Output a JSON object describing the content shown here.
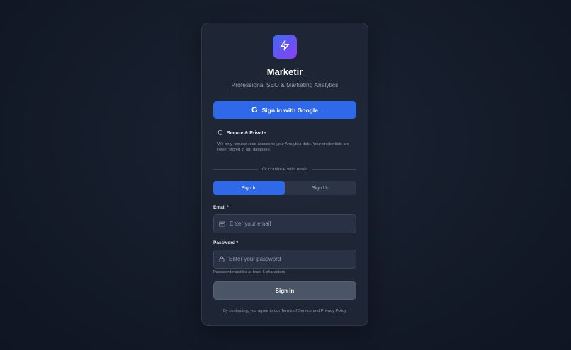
{
  "brand": {
    "name": "Marketir",
    "tagline": "Professional SEO & Marketing Analytics",
    "logo_icon": "lightning-bolt-icon",
    "gradient": [
      "#3d6bf0",
      "#8b3ff2"
    ]
  },
  "google": {
    "label": "Sign in with Google",
    "icon": "google-g-icon"
  },
  "secure": {
    "title": "Secure & Private",
    "icon": "shield-icon",
    "text": "We only request read access to your Analytics data. Your credentials are never stored in our database."
  },
  "divider": {
    "text": "Or continue with email"
  },
  "tabs": [
    {
      "label": "Sign In",
      "active": true
    },
    {
      "label": "Sign Up",
      "active": false
    }
  ],
  "form": {
    "email_label": "Email *",
    "email_placeholder": "Enter your email",
    "email_value": "",
    "email_icon": "mail-icon",
    "password_label": "Password *",
    "password_placeholder": "Enter your password",
    "password_value": "",
    "password_icon": "lock-icon",
    "password_hint": "Password must be at least 6 characters",
    "submit_label": "Sign In"
  },
  "footer": {
    "terms": "By continuing, you agree to our Terms of Service and Privacy Policy"
  },
  "colors": {
    "primary": "#2f68e8",
    "card": "#1f2736",
    "background": "#141b29"
  }
}
